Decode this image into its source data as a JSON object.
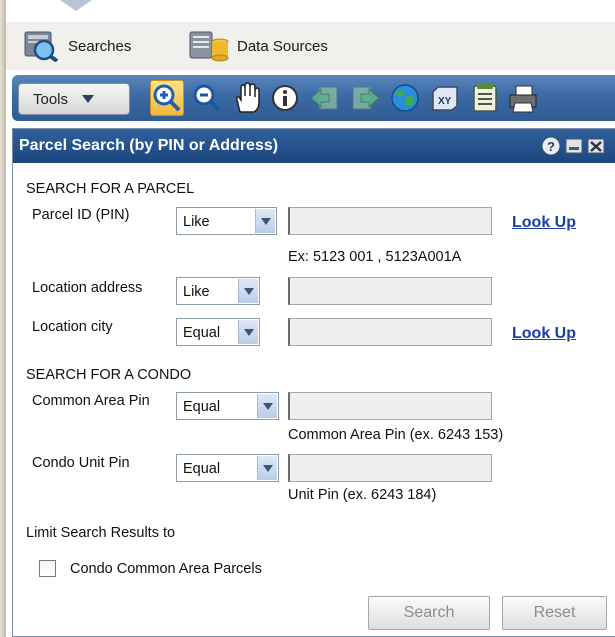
{
  "nav": {
    "searches_label": "Searches",
    "data_sources_label": "Data Sources"
  },
  "toolbar": {
    "tools_label": "Tools",
    "active_tool": "zoom-in",
    "icons": [
      "zoom-in-icon",
      "zoom-out-icon",
      "pan-hand-icon",
      "identify-info-icon",
      "previous-extent-icon",
      "next-extent-icon",
      "full-extent-globe-icon",
      "xy-coordinate-icon",
      "notepad-icon",
      "print-icon"
    ]
  },
  "panel": {
    "title": "Parcel Search (by PIN or Address)",
    "parcel_section_label": "SEARCH FOR A PARCEL",
    "parcel_id": {
      "label": "Parcel ID (PIN)",
      "operator": "Like",
      "value": "",
      "example": "Ex: 5123 001 , 5123A001A",
      "lookup_label": "Look Up"
    },
    "location_address": {
      "label": "Location address",
      "operator": "Like",
      "value": ""
    },
    "location_city": {
      "label": "Location city",
      "operator": "Equal",
      "value": "",
      "lookup_label": "Look Up"
    },
    "condo_section_label": "SEARCH FOR A CONDO",
    "common_area_pin": {
      "label": "Common Area Pin",
      "operator": "Equal",
      "value": "",
      "example": "Common Area Pin (ex. 6243 153)"
    },
    "condo_unit_pin": {
      "label": "Condo Unit Pin",
      "operator": "Equal",
      "value": "",
      "example": "Unit Pin (ex. 6243 184)"
    },
    "limit_label": "Limit Search Results to",
    "condo_common_checkbox": {
      "label": "Condo Common Area Parcels",
      "checked": false
    },
    "search_button": "Search",
    "reset_button": "Reset"
  },
  "colors": {
    "toolbar_blue": "#3c6aa4",
    "panel_header_blue": "#1c477e",
    "link_blue": "#1a3fa3",
    "active_tool_yellow": "#f2b63b"
  }
}
